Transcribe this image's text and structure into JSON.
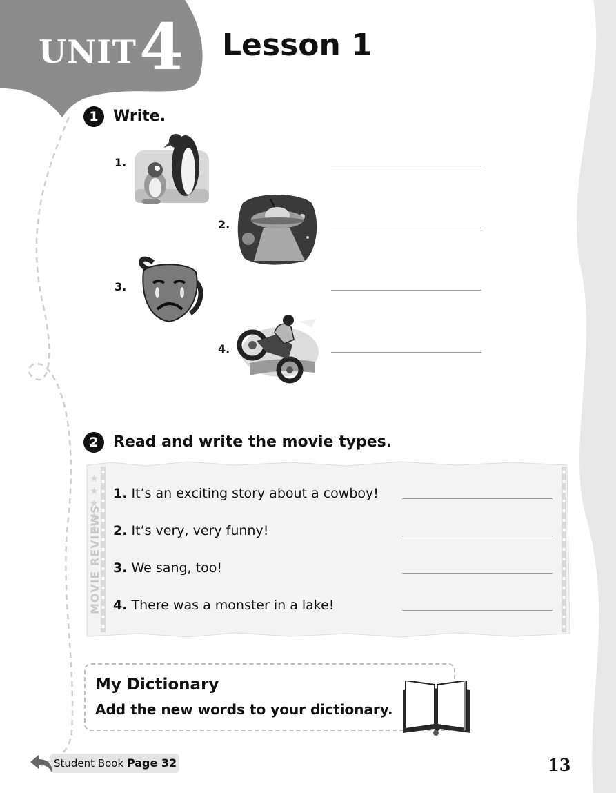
{
  "header": {
    "unit_word": "UNIT",
    "unit_number": "4",
    "lesson_title": "Lesson 1"
  },
  "section1": {
    "number": "1",
    "title": "Write.",
    "items": [
      {
        "number": "1.",
        "picture": "penguins-icon"
      },
      {
        "number": "2.",
        "picture": "flying-saucer-icon"
      },
      {
        "number": "3.",
        "picture": "sad-mask-icon"
      },
      {
        "number": "4.",
        "picture": "motorcycle-rider-icon"
      }
    ]
  },
  "section2": {
    "number": "2",
    "title": "Read and write the movie types.",
    "side_label": "MOVIE REVIEWS",
    "items": [
      {
        "number": "1.",
        "text": "It’s an exciting story about a cowboy!"
      },
      {
        "number": "2.",
        "text": "It’s very, very funny!"
      },
      {
        "number": "3.",
        "text": "We sang, too!"
      },
      {
        "number": "4.",
        "text": "There was a monster in a lake!"
      }
    ]
  },
  "dictionary": {
    "title": "My Dictionary",
    "instruction": "Add the new words to your dictionary.",
    "icon": "open-book-icon"
  },
  "footer": {
    "student_book_label": "Student Book",
    "page_ref": "Page 32",
    "page_number": "13"
  }
}
